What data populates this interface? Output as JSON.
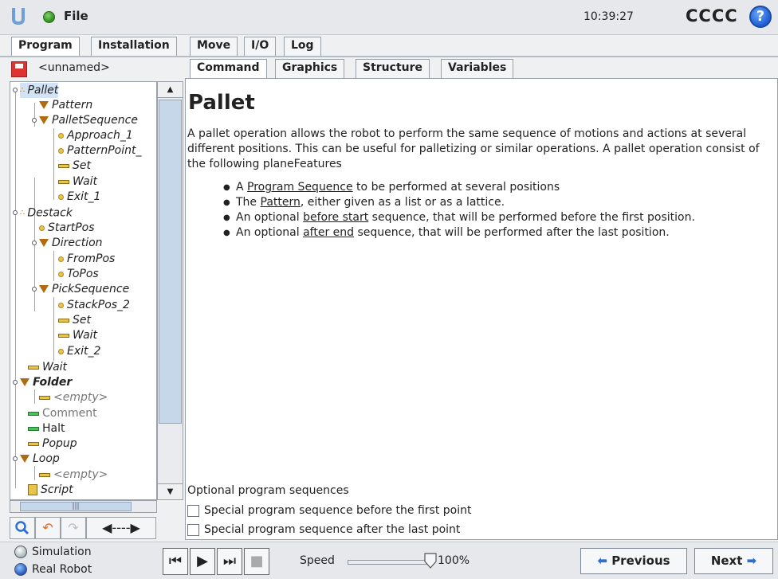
{
  "titlebar": {
    "file_label": "File",
    "clock": "10:39:27",
    "robot_name": "CCCC",
    "help_label": "?"
  },
  "top_tabs": [
    "Program",
    "Installation",
    "Move",
    "I/O",
    "Log"
  ],
  "active_top_tab": "Program",
  "left_panel": {
    "program_name": "<unnamed>",
    "tree": [
      {
        "label": "Pallet",
        "icon": "pallet-icon"
      },
      {
        "label": "Pattern",
        "icon": "triangle-icon"
      },
      {
        "label": "PalletSequence",
        "icon": "triangle-icon"
      },
      {
        "label": "Approach_1",
        "icon": "waypoint-icon"
      },
      {
        "label": "PatternPoint_",
        "icon": "waypoint-icon"
      },
      {
        "label": "Set",
        "icon": "bar-icon"
      },
      {
        "label": "Wait",
        "icon": "bar-icon"
      },
      {
        "label": "Exit_1",
        "icon": "waypoint-icon"
      },
      {
        "label": "Destack",
        "icon": "pallet-icon"
      },
      {
        "label": "StartPos",
        "icon": "waypoint-icon"
      },
      {
        "label": "Direction",
        "icon": "triangle-icon"
      },
      {
        "label": "FromPos",
        "icon": "waypoint-icon"
      },
      {
        "label": "ToPos",
        "icon": "waypoint-icon"
      },
      {
        "label": "PickSequence",
        "icon": "triangle-icon"
      },
      {
        "label": "StackPos_2",
        "icon": "waypoint-icon"
      },
      {
        "label": "Set",
        "icon": "bar-icon"
      },
      {
        "label": "Wait",
        "icon": "bar-icon"
      },
      {
        "label": "Exit_2",
        "icon": "waypoint-icon"
      },
      {
        "label": "Wait",
        "icon": "bar-icon"
      },
      {
        "label": "Folder",
        "icon": "triangle-icon"
      },
      {
        "label": "<empty>",
        "icon": "bar-icon"
      },
      {
        "label": "Comment",
        "icon": "bar-icon-green"
      },
      {
        "label": "Halt",
        "icon": "bar-icon-green"
      },
      {
        "label": "Popup",
        "icon": "bar-icon"
      },
      {
        "label": "Loop",
        "icon": "triangle-icon"
      },
      {
        "label": "<empty>",
        "icon": "bar-icon"
      },
      {
        "label": "Script",
        "icon": "script-icon"
      }
    ],
    "hscroll_glyph": "|||"
  },
  "sub_tabs": [
    "Command",
    "Graphics",
    "Structure",
    "Variables"
  ],
  "active_sub_tab": "Command",
  "content": {
    "title": "Pallet",
    "description": "A pallet operation allows the robot to perform the same sequence of motions and actions at several different positions. This can be useful for palletizing or similar operations. A pallet operation consist of the following planeFeatures",
    "bullets": [
      {
        "pre": "A ",
        "link": "Program Sequence",
        "post": " to be performed at several positions"
      },
      {
        "pre": "The ",
        "link": "Pattern",
        "post": ", either given as a list or as a lattice."
      },
      {
        "pre": "An optional ",
        "link": "before start",
        "post": " sequence, that will be performed before the first position."
      },
      {
        "pre": "An optional ",
        "link": "after end",
        "post": " sequence, that will be performed after the last position."
      }
    ],
    "optional_heading": "Optional program sequences",
    "checkbox_before": "Special program sequence before the first point",
    "checkbox_after": "Special program sequence after the last point",
    "checkbox_before_checked": false,
    "checkbox_after_checked": false
  },
  "footer": {
    "simulation_label": "Simulation",
    "real_robot_label": "Real Robot",
    "selected_mode": "Real Robot",
    "speed_label": "Speed",
    "speed_value": "100%",
    "speed_fraction": 1.0,
    "previous_label": "Previous",
    "next_label": "Next"
  },
  "colors": {
    "status_green": "#2f8a1c",
    "help_blue": "#1f5fd0",
    "selection": "#d3e3f6",
    "nav_arrow_blue": "#2a6fd6",
    "undo_orange": "#e06a1a"
  }
}
